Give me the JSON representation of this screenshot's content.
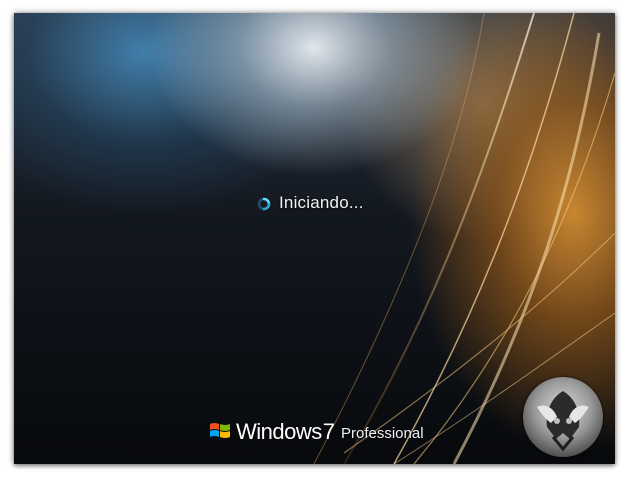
{
  "boot_screen": {
    "status_text": "Iniciando...",
    "spinner_icon": "loading-spinner-icon",
    "colors": {
      "accent_orange": "#d28c32",
      "accent_blue": "#468cbe",
      "background_dark": "#07090c"
    }
  },
  "branding": {
    "logo_icon": "windows-flag-icon",
    "product_name": "Windows",
    "version": "7",
    "edition": "Professional"
  },
  "badge": {
    "icon": "user-emblem-icon"
  }
}
